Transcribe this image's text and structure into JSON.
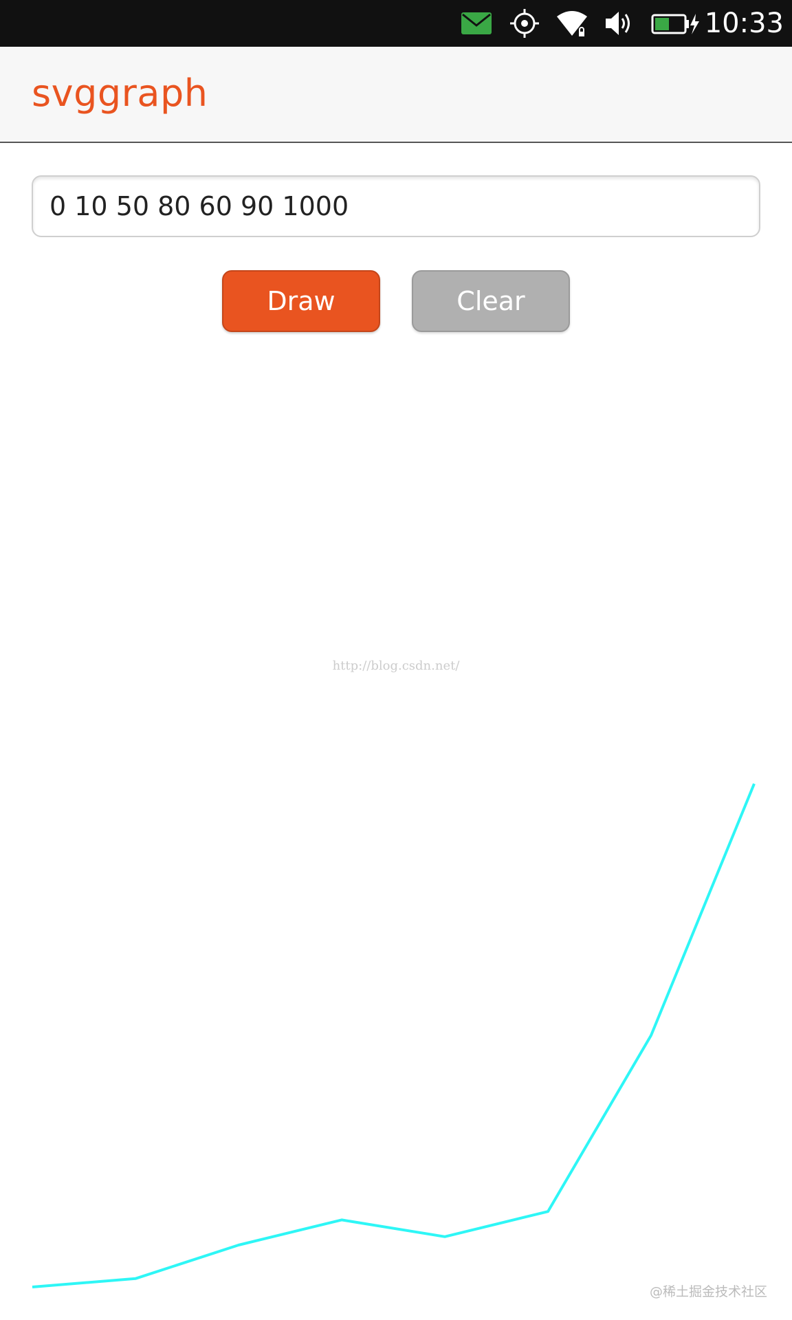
{
  "status_bar": {
    "time": "10:33",
    "icons": [
      "message-icon",
      "location-icon",
      "wifi-icon",
      "volume-icon",
      "battery-charging-icon"
    ],
    "message_icon_color": "#3aa845",
    "battery_fill_color": "#3aa845"
  },
  "header": {
    "title": "svggraph",
    "title_color": "#e95420"
  },
  "input": {
    "value": "0 10 50 80 60 90 1000"
  },
  "buttons": {
    "draw_label": "Draw",
    "clear_label": "Clear",
    "draw_color": "#e95420",
    "clear_color": "#b0b0b0"
  },
  "watermarks": {
    "top": "http://blog.csdn.net/",
    "bottom": "@稀土掘金技术社区"
  },
  "chart_data": {
    "type": "line",
    "x": [
      0,
      1,
      2,
      3,
      4,
      5,
      6,
      7
    ],
    "series": [
      {
        "values": [
          0,
          10,
          50,
          80,
          60,
          90,
          300,
          600
        ],
        "color": "#2ef6f6"
      }
    ],
    "ylim": [
      0,
      600
    ],
    "grid": false,
    "axes_visible": false
  }
}
